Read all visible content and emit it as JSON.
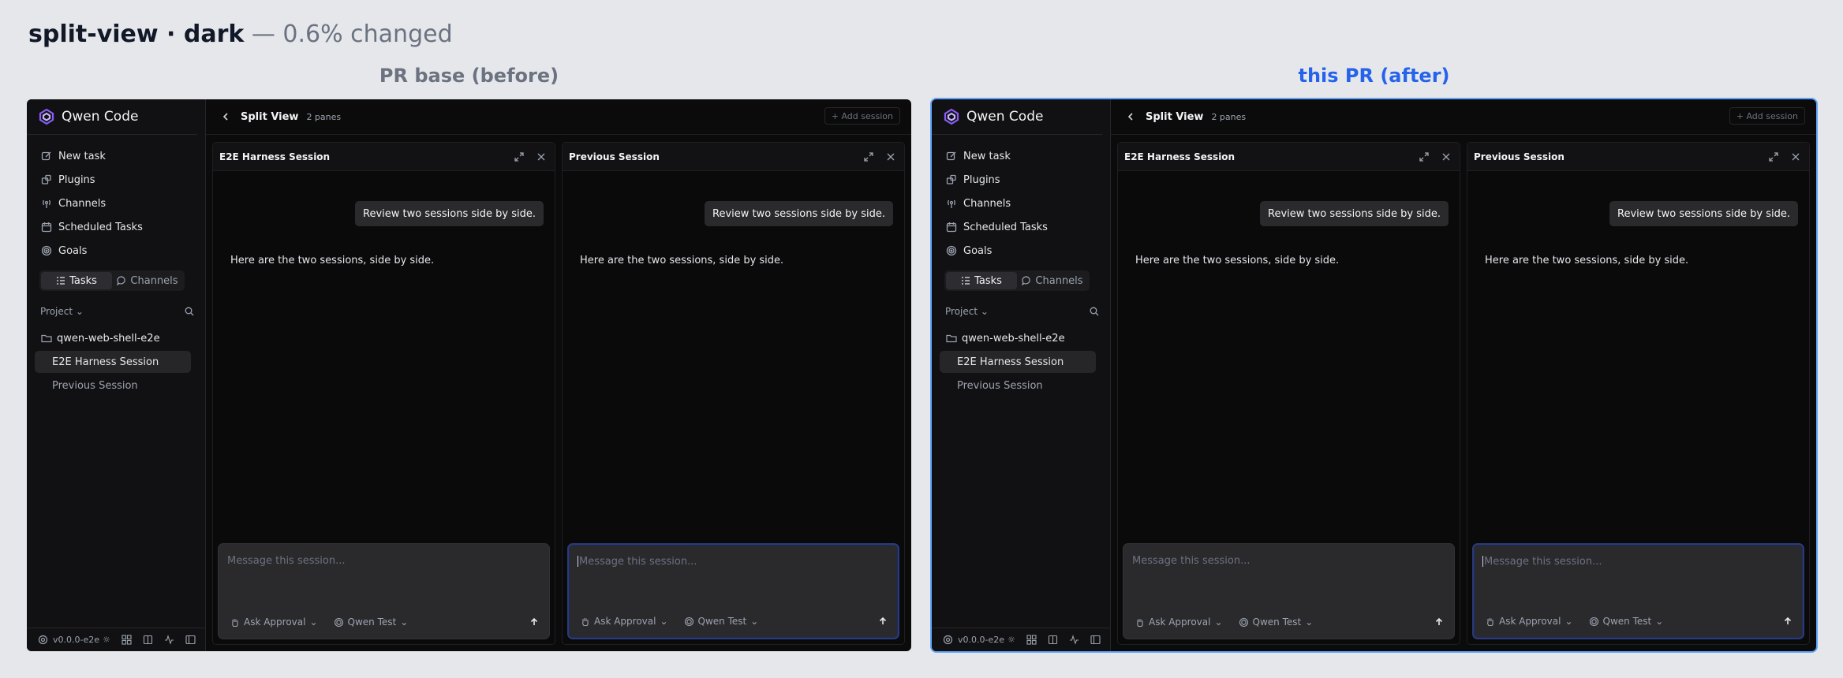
{
  "heading": {
    "bold": "split-view · dark",
    "rest": " — 0.6% changed"
  },
  "columns": [
    {
      "label": "PR base (before)"
    },
    {
      "label": "this PR (after)"
    }
  ],
  "app": {
    "brand": "Qwen Code",
    "nav": [
      "New task",
      "Plugins",
      "Channels",
      "Scheduled Tasks",
      "Goals"
    ],
    "segment": {
      "tasks": "Tasks",
      "channels": "Channels"
    },
    "project_label": "Project",
    "folder": "qwen-web-shell-e2e",
    "sessions": [
      "E2E Harness Session",
      "Previous Session"
    ],
    "version": "v0.0.0-e2e",
    "topbar": {
      "title": "Split View",
      "count": "2 panes",
      "add": "+ Add session"
    },
    "panes": [
      {
        "title": "E2E Harness Session"
      },
      {
        "title": "Previous Session"
      }
    ],
    "user_message": "Review two sessions side by side.",
    "assistant_message": "Here are the two sessions, side by side.",
    "composer": {
      "placeholder": "Message this session...",
      "approval": "Ask Approval",
      "model": "Qwen Test"
    },
    "colors": {
      "accent_after": "#2563eb",
      "focus_ring": "#2b3a7a"
    }
  }
}
